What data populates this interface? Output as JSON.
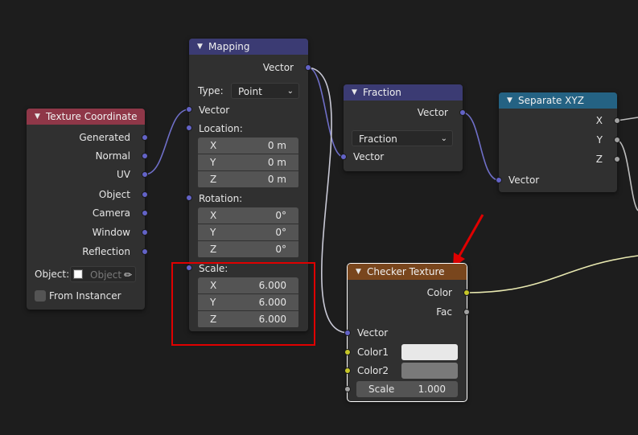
{
  "nodes": {
    "texcoord": {
      "title": "Texture Coordinate",
      "header_color": "#8f3748",
      "outputs": [
        "Generated",
        "Normal",
        "UV",
        "Object",
        "Camera",
        "Window",
        "Reflection"
      ],
      "object_label": "Object:",
      "object_placeholder": "Object",
      "from_instancer": "From Instancer"
    },
    "mapping": {
      "title": "Mapping",
      "header_color": "#3b3b73",
      "output": "Vector",
      "type_label": "Type:",
      "type_value": "Point",
      "vector_in": "Vector",
      "location": {
        "label": "Location:",
        "x": "0 m",
        "y": "0 m",
        "z": "0 m"
      },
      "rotation": {
        "label": "Rotation:",
        "x": "0°",
        "y": "0°",
        "z": "0°"
      },
      "scale": {
        "label": "Scale:",
        "x": "6.000",
        "y": "6.000",
        "z": "6.000"
      },
      "axis": {
        "x": "X",
        "y": "Y",
        "z": "Z"
      }
    },
    "fraction": {
      "title": "Fraction",
      "header_color": "#3b3b73",
      "output": "Vector",
      "op_value": "Fraction",
      "input": "Vector"
    },
    "separate": {
      "title": "Separate XYZ",
      "header_color": "#246283",
      "outputs": [
        "X",
        "Y",
        "Z"
      ],
      "input": "Vector"
    },
    "checker": {
      "title": "Checker Texture",
      "header_color": "#79461d",
      "out_color": "Color",
      "out_fac": "Fac",
      "in_vector": "Vector",
      "color1_label": "Color1",
      "color1": "#e8e8e8",
      "color2_label": "Color2",
      "color2": "#7a7a7a",
      "scale_label": "Scale",
      "scale_value": "1.000"
    }
  },
  "annotations": {
    "highlight_color": "#e00000",
    "arrow_color": "#e00000"
  }
}
